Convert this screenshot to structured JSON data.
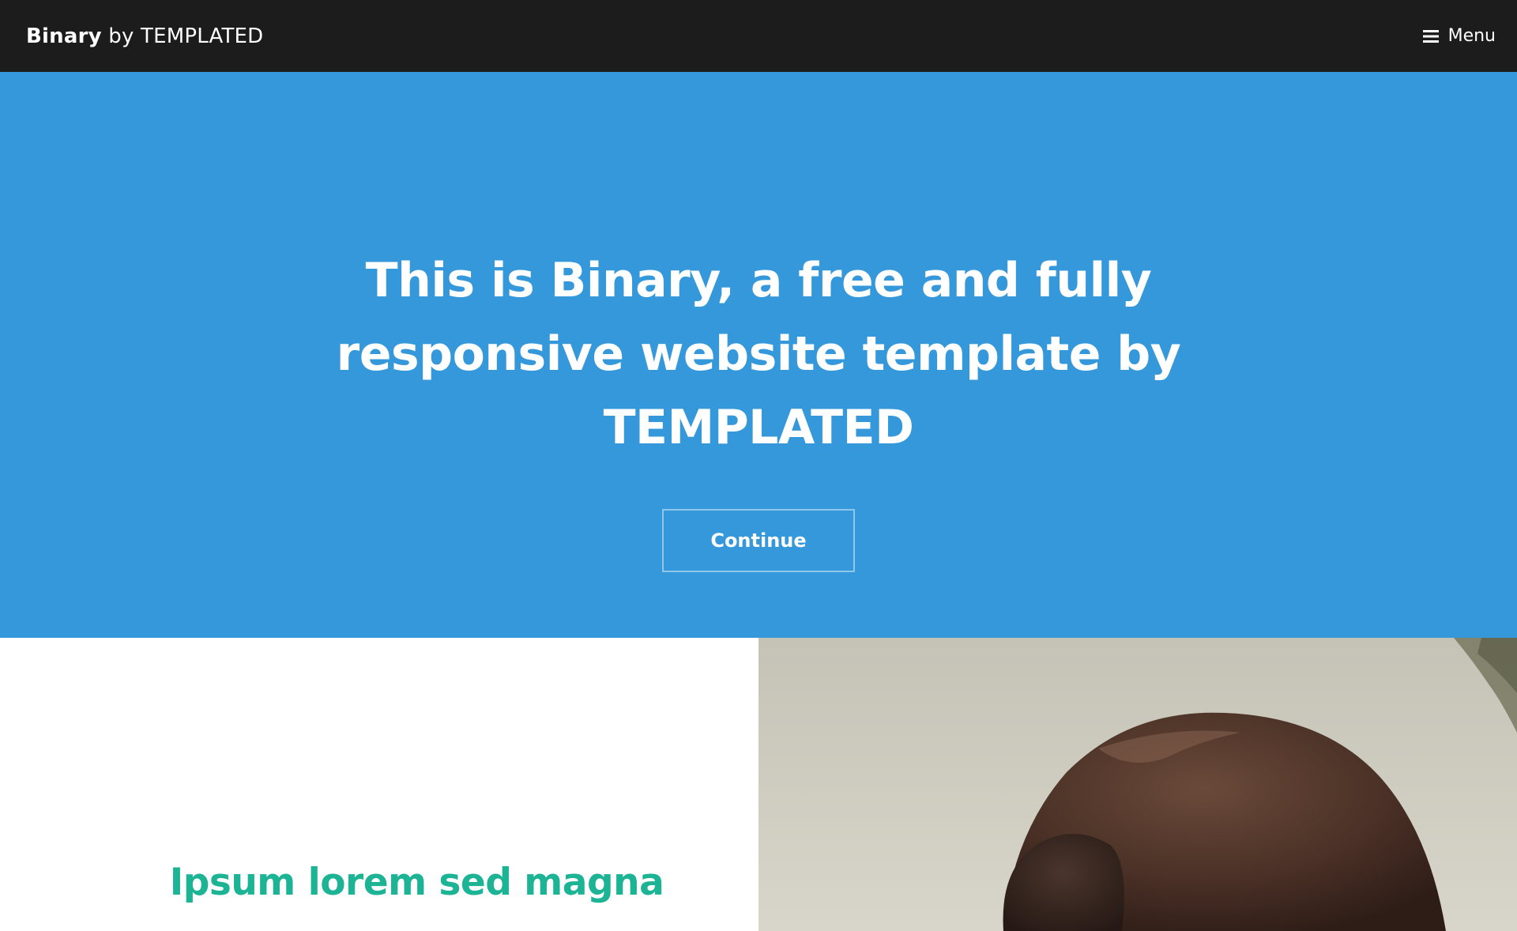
{
  "header": {
    "logo_brand": "Binary",
    "logo_suffix": "by TEMPLATED",
    "menu_label": "Menu",
    "menu_icon": "hamburger-icon"
  },
  "banner": {
    "heading": "This is Binary, a free and fully responsive website template by TEMPLATED",
    "button_label": "Continue",
    "background_color": "#3598db"
  },
  "section": {
    "heading": "Ipsum lorem sed magna",
    "heading_color": "#1cb495",
    "image": "photo-of-people-hair"
  },
  "colors": {
    "header_bg": "#1c1c1c",
    "banner_bg": "#3598db",
    "accent": "#1cb495"
  }
}
